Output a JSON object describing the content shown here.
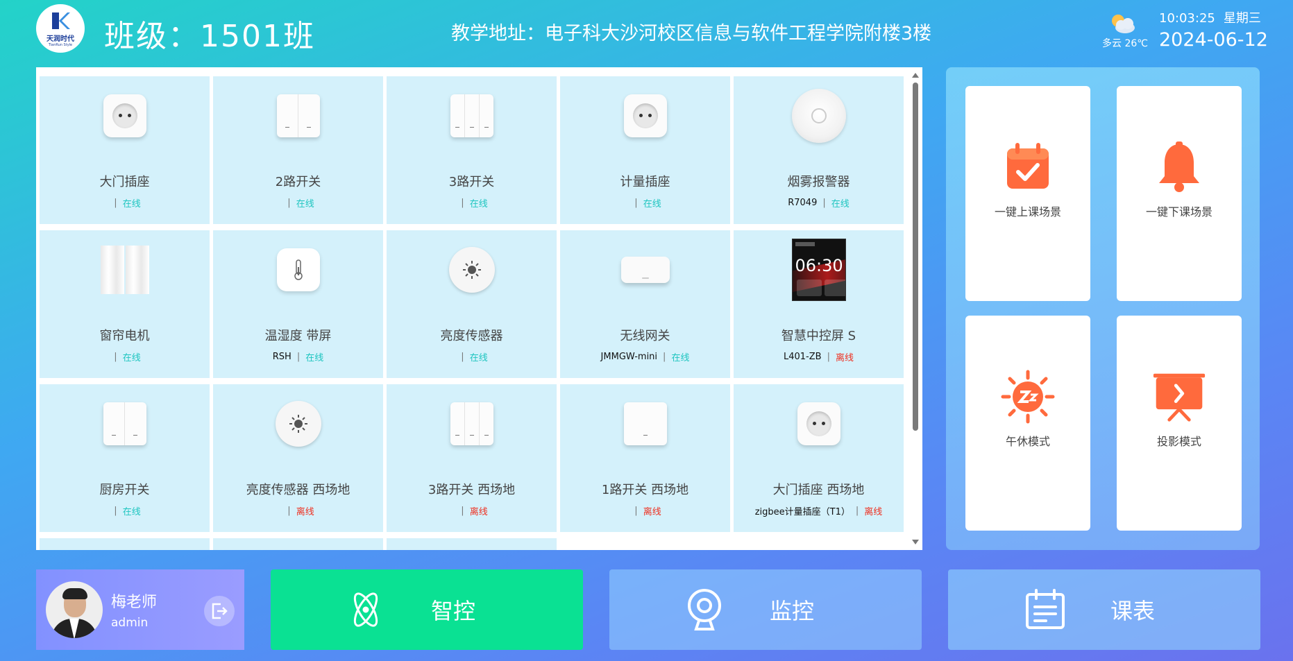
{
  "header": {
    "logo_text": "天润时代",
    "logo_sub": "TianRun Style",
    "class_label": "班级：",
    "class_name": "1501班",
    "address": "教学地址：电子科大沙河校区信息与软件工程学院附楼3楼",
    "weather": "多云 26℃",
    "weather_icon": "partly-cloudy-icon",
    "time": "10:03:25",
    "weekday": "星期三",
    "date": "2024-06-12"
  },
  "devices": [
    {
      "name": "大门插座",
      "model": "",
      "status": "在线",
      "online": true,
      "icon": "socket"
    },
    {
      "name": "2路开关",
      "model": "",
      "status": "在线",
      "online": true,
      "icon": "switch-2"
    },
    {
      "name": "3路开关",
      "model": "",
      "status": "在线",
      "online": true,
      "icon": "switch-3"
    },
    {
      "name": "计量插座",
      "model": "",
      "status": "在线",
      "online": true,
      "icon": "socket"
    },
    {
      "name": "烟雾报警器",
      "model": "R7049",
      "status": "在线",
      "online": true,
      "icon": "smoke"
    },
    {
      "name": "窗帘电机",
      "model": "",
      "status": "在线",
      "online": true,
      "icon": "curtain"
    },
    {
      "name": "温湿度 带屏",
      "model": "RSH",
      "status": "在线",
      "online": true,
      "icon": "thermo"
    },
    {
      "name": "亮度传感器",
      "model": "",
      "status": "在线",
      "online": true,
      "icon": "bright"
    },
    {
      "name": "无线网关",
      "model": "JMMGW-mini",
      "status": "在线",
      "online": true,
      "icon": "gateway"
    },
    {
      "name": "智慧中控屏 S",
      "model": "L401-ZB",
      "status": "离线",
      "online": false,
      "icon": "screen"
    },
    {
      "name": "厨房开关",
      "model": "",
      "status": "在线",
      "online": true,
      "icon": "switch-2"
    },
    {
      "name": "亮度传感器 西场地",
      "model": "",
      "status": "离线",
      "online": false,
      "icon": "bright"
    },
    {
      "name": "3路开关 西场地",
      "model": "",
      "status": "离线",
      "online": false,
      "icon": "switch-3"
    },
    {
      "name": "1路开关 西场地",
      "model": "",
      "status": "离线",
      "online": false,
      "icon": "switch-1"
    },
    {
      "name": "大门插座 西场地",
      "model": "zigbee计量插座（T1）",
      "status": "离线",
      "online": false,
      "icon": "socket"
    }
  ],
  "screen_time": "06:30",
  "scenes": [
    {
      "label": "一键上课场景",
      "icon": "calendar-check-icon"
    },
    {
      "label": "一键下课场景",
      "icon": "bell-icon"
    },
    {
      "label": "午休模式",
      "icon": "sun-sleep-icon"
    },
    {
      "label": "投影模式",
      "icon": "projector-icon"
    }
  ],
  "user": {
    "name": "梅老师",
    "role": "admin"
  },
  "nav": {
    "smart": "智控",
    "monitor": "监控",
    "schedule": "课表"
  },
  "colors": {
    "online": "#1ec5c0",
    "offline": "#ee3020",
    "accent_green": "#0ae193",
    "scene_orange": "#ff6a3d"
  }
}
